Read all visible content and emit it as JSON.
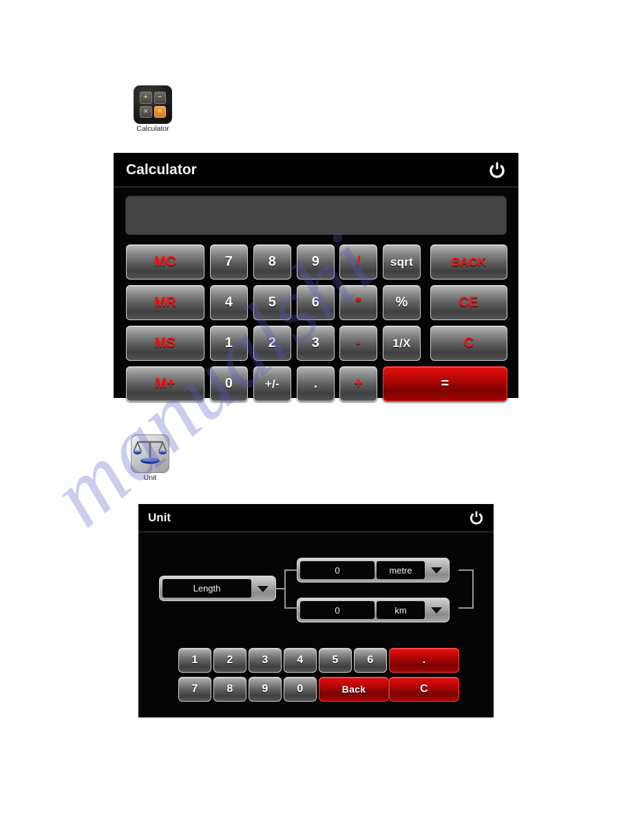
{
  "desktop": {
    "icons": [
      {
        "id": "calculator",
        "label": "Calculator",
        "icon_name": "calculator-app-icon",
        "keys": [
          "+",
          "−",
          "×",
          "="
        ]
      },
      {
        "id": "unit",
        "label": "Unit",
        "icon_name": "balance-scale-app-icon"
      }
    ]
  },
  "watermark": {
    "text": "manualshi"
  },
  "calculator_window": {
    "title": "Calculator",
    "power_icon": "power-icon",
    "display": {
      "value": "",
      "placeholder": ""
    },
    "keys": [
      {
        "label": "MC",
        "color": "red",
        "style": "grey",
        "row": 0,
        "col": 0,
        "span": "wide-left"
      },
      {
        "label": "7",
        "color": "white",
        "style": "grey",
        "row": 0,
        "col": 1,
        "span": "normal"
      },
      {
        "label": "8",
        "color": "white",
        "style": "grey",
        "row": 0,
        "col": 2,
        "span": "normal"
      },
      {
        "label": "9",
        "color": "white",
        "style": "grey",
        "row": 0,
        "col": 3,
        "span": "normal"
      },
      {
        "label": "/",
        "color": "red",
        "style": "grey",
        "row": 0,
        "col": 4,
        "span": "normal"
      },
      {
        "label": "sqrt",
        "color": "white",
        "style": "grey",
        "row": 0,
        "col": 5,
        "span": "normal"
      },
      {
        "label": "BACK",
        "color": "red",
        "style": "grey",
        "row": 0,
        "col": 6,
        "span": "wide-right"
      },
      {
        "label": "MR",
        "color": "red",
        "style": "grey",
        "row": 1,
        "col": 0,
        "span": "wide-left"
      },
      {
        "label": "4",
        "color": "white",
        "style": "grey",
        "row": 1,
        "col": 1,
        "span": "normal"
      },
      {
        "label": "5",
        "color": "white",
        "style": "grey",
        "row": 1,
        "col": 2,
        "span": "normal"
      },
      {
        "label": "6",
        "color": "white",
        "style": "grey",
        "row": 1,
        "col": 3,
        "span": "normal"
      },
      {
        "label": "*",
        "color": "red",
        "style": "grey",
        "row": 1,
        "col": 4,
        "span": "normal"
      },
      {
        "label": "%",
        "color": "white",
        "style": "grey",
        "row": 1,
        "col": 5,
        "span": "normal"
      },
      {
        "label": "CE",
        "color": "red",
        "style": "grey",
        "row": 1,
        "col": 6,
        "span": "wide-right"
      },
      {
        "label": "MS",
        "color": "red",
        "style": "grey",
        "row": 2,
        "col": 0,
        "span": "wide-left"
      },
      {
        "label": "1",
        "color": "white",
        "style": "grey",
        "row": 2,
        "col": 1,
        "span": "normal"
      },
      {
        "label": "2",
        "color": "white",
        "style": "grey",
        "row": 2,
        "col": 2,
        "span": "normal"
      },
      {
        "label": "3",
        "color": "white",
        "style": "grey",
        "row": 2,
        "col": 3,
        "span": "normal"
      },
      {
        "label": "-",
        "color": "red",
        "style": "grey",
        "row": 2,
        "col": 4,
        "span": "normal"
      },
      {
        "label": "1/X",
        "color": "white",
        "style": "grey",
        "row": 2,
        "col": 5,
        "span": "normal"
      },
      {
        "label": "C",
        "color": "red",
        "style": "grey",
        "row": 2,
        "col": 6,
        "span": "wide-right"
      },
      {
        "label": "M+",
        "color": "red",
        "style": "grey",
        "row": 3,
        "col": 0,
        "span": "wide-left"
      },
      {
        "label": "0",
        "color": "white",
        "style": "grey",
        "row": 3,
        "col": 1,
        "span": "normal"
      },
      {
        "label": "+/-",
        "color": "white",
        "style": "grey",
        "row": 3,
        "col": 2,
        "span": "normal"
      },
      {
        "label": ".",
        "color": "white",
        "style": "grey",
        "row": 3,
        "col": 3,
        "span": "normal"
      },
      {
        "label": "+",
        "color": "red",
        "style": "grey",
        "row": 3,
        "col": 4,
        "span": "normal"
      },
      {
        "label": "=",
        "color": "white",
        "style": "red",
        "row": 3,
        "col": 5,
        "span": "equals"
      }
    ]
  },
  "unit_window": {
    "title": "Unit",
    "power_icon": "power-icon",
    "category": {
      "value": "Length",
      "arrow_icon": "chevron-down-icon"
    },
    "conversions": [
      {
        "value": "0",
        "unit": "metre",
        "arrow_icon": "chevron-down-icon"
      },
      {
        "value": "0",
        "unit": "km",
        "arrow_icon": "chevron-down-icon"
      }
    ],
    "keys": [
      {
        "label": "1",
        "style": "grey",
        "row": 0,
        "col": 0,
        "span": "normal"
      },
      {
        "label": "2",
        "style": "grey",
        "row": 0,
        "col": 1,
        "span": "normal"
      },
      {
        "label": "3",
        "style": "grey",
        "row": 0,
        "col": 2,
        "span": "normal"
      },
      {
        "label": "4",
        "style": "grey",
        "row": 0,
        "col": 3,
        "span": "normal"
      },
      {
        "label": "5",
        "style": "grey",
        "row": 0,
        "col": 4,
        "span": "normal"
      },
      {
        "label": "6",
        "style": "grey",
        "row": 0,
        "col": 5,
        "span": "normal"
      },
      {
        "label": ".",
        "style": "red",
        "row": 0,
        "col": 6,
        "span": "wide2"
      },
      {
        "label": "7",
        "style": "grey",
        "row": 1,
        "col": 0,
        "span": "normal"
      },
      {
        "label": "8",
        "style": "grey",
        "row": 1,
        "col": 1,
        "span": "normal"
      },
      {
        "label": "9",
        "style": "grey",
        "row": 1,
        "col": 2,
        "span": "normal"
      },
      {
        "label": "0",
        "style": "grey",
        "row": 1,
        "col": 3,
        "span": "normal"
      },
      {
        "label": "Back",
        "style": "red",
        "row": 1,
        "col": 4,
        "span": "wide2"
      },
      {
        "label": "C",
        "style": "red",
        "row": 1,
        "col": 6,
        "span": "wide2"
      }
    ]
  },
  "colors": {
    "accent_red": "#ff1414",
    "key_red_bg": "#c00707",
    "window_bg": "#050505",
    "display_bg": "#444444",
    "watermark": "#5656c8"
  }
}
